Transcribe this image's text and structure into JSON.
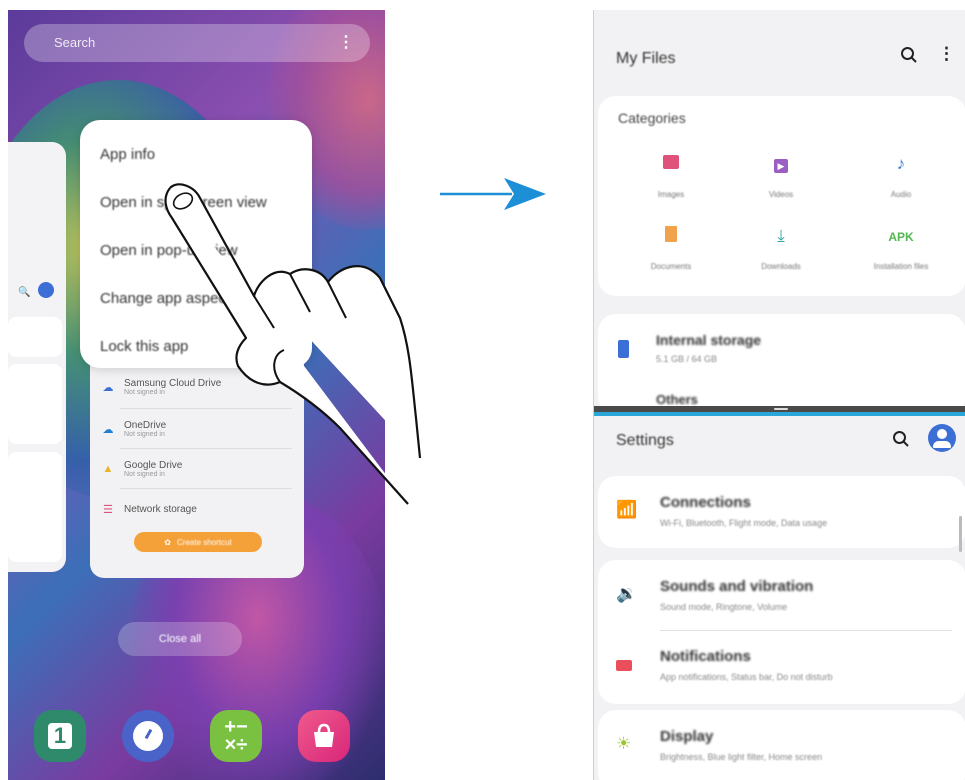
{
  "left": {
    "search_placeholder": "Search",
    "menu": [
      "App info",
      "Open in split screen view",
      "Open in pop-up view",
      "Change app aspect",
      "Lock this app"
    ],
    "storage_items": [
      {
        "label": "Samsung Cloud Drive",
        "sub": "Not signed in"
      },
      {
        "label": "OneDrive",
        "sub": "Not signed in"
      },
      {
        "label": "Google Drive",
        "sub": "Not signed in"
      },
      {
        "label": "Network storage",
        "sub": ""
      }
    ],
    "create_label": "Create shortcut",
    "close_all": "Close all",
    "dock": [
      "calendar-icon",
      "clock-icon",
      "calculator-icon",
      "galaxy-store-icon"
    ],
    "dock_calendar_day": "1"
  },
  "right": {
    "files": {
      "title": "My Files",
      "categories_title": "Categories",
      "categories": [
        {
          "icon": "image-icon",
          "label": "Images",
          "color": "#e0527c"
        },
        {
          "icon": "video-icon",
          "label": "Videos",
          "color": "#9b5ec4"
        },
        {
          "icon": "audio-icon",
          "label": "Audio",
          "color": "#3c7dd6"
        },
        {
          "icon": "document-icon",
          "label": "Documents",
          "color": "#f0a34a"
        },
        {
          "icon": "download-icon",
          "label": "Downloads",
          "color": "#3aa9a0"
        },
        {
          "icon": "apk-icon",
          "label": "Installation files",
          "color": "#52b852",
          "glyph": "APK"
        }
      ],
      "internal_storage": "Internal storage",
      "internal_storage_sub": "5.1 GB / 64 GB",
      "other": "Others"
    },
    "settings": {
      "title": "Settings",
      "rows": [
        {
          "icon": "wifi-icon",
          "title": "Connections",
          "sub": "Wi-Fi, Bluetooth, Flight mode, Data usage",
          "color": "#2aa7d8"
        },
        {
          "icon": "volume-icon",
          "title": "Sounds and vibration",
          "sub": "Sound mode, Ringtone, Volume",
          "color": "#6b6fd6"
        },
        {
          "icon": "notification-icon",
          "title": "Notifications",
          "sub": "App notifications, Status bar, Do not disturb",
          "color": "#e94e5a"
        },
        {
          "icon": "display-icon",
          "title": "Display",
          "sub": "Brightness, Blue light filter, Home screen",
          "color": "#9cc630"
        }
      ]
    }
  },
  "colors": {
    "arrow": "#1c8fd6",
    "accent": "#2aa7d8"
  }
}
